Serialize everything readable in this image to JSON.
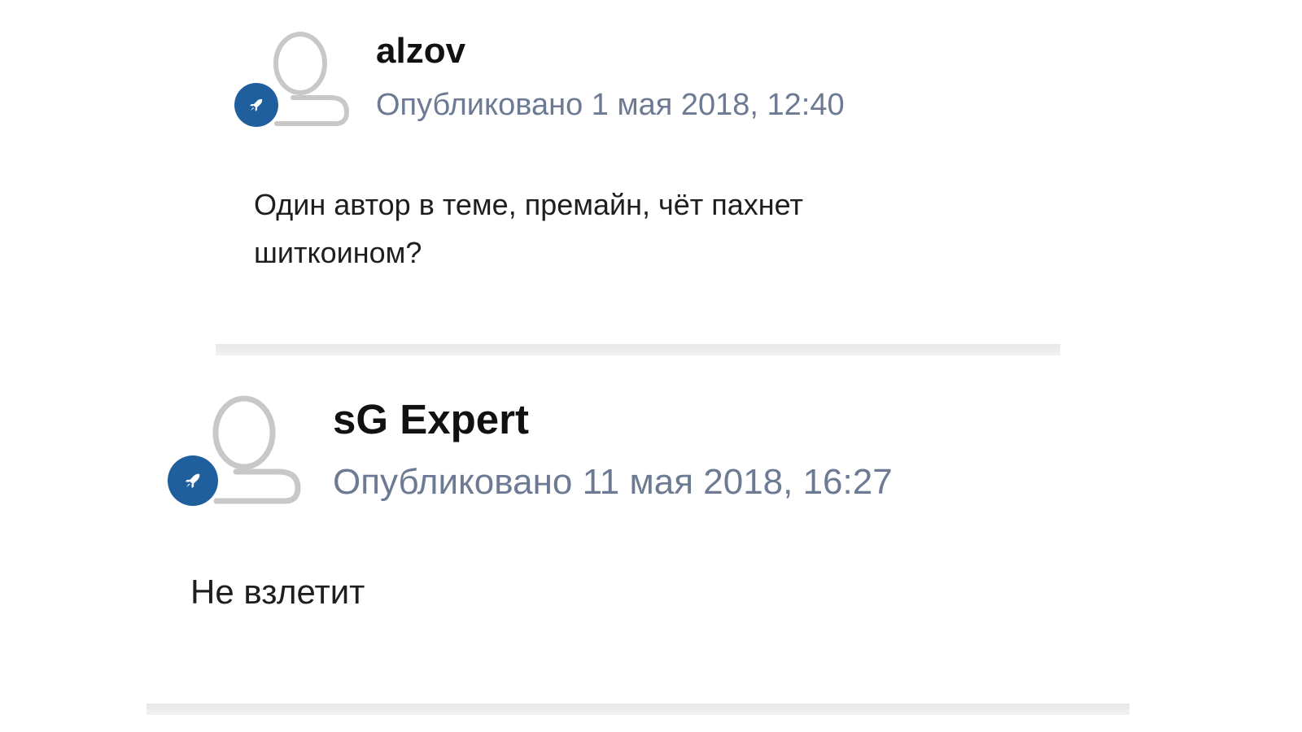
{
  "posts": [
    {
      "author": "alzov",
      "meta": "Опубликовано 1 мая 2018, 12:40",
      "body_line1": "Один автор в теме, премайн, чёт пахнет",
      "body_line2": "шиткоином?",
      "avatar_icon": "default-user-avatar-icon",
      "badge_icon": "rocket-icon"
    },
    {
      "author": "sG Expert",
      "meta": "Опубликовано 11 мая 2018, 16:27",
      "body_line1": "Не взлетит",
      "avatar_icon": "default-user-avatar-icon",
      "badge_icon": "rocket-icon"
    }
  ],
  "colors": {
    "badge": "#1f5f9e",
    "meta_text": "#6c7a93",
    "avatar_outline": "#c8c8c8"
  }
}
